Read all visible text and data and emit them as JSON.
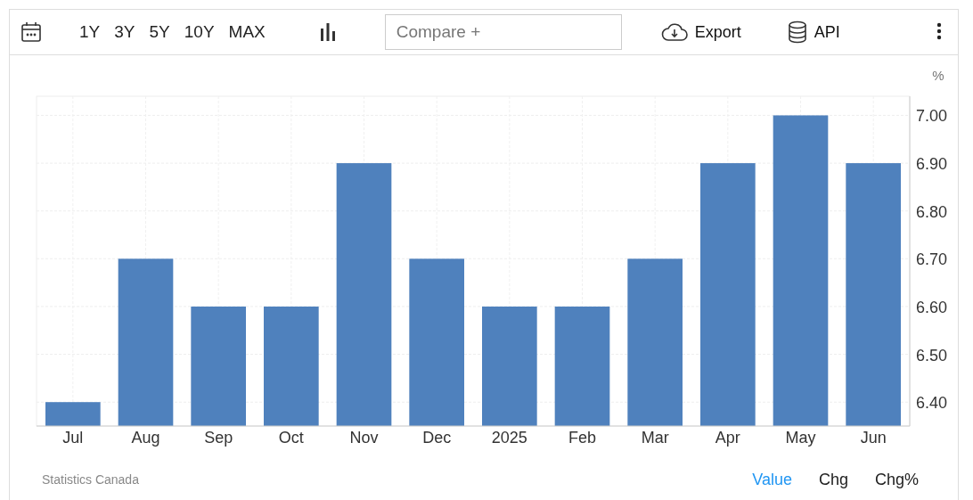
{
  "toolbar": {
    "ranges": [
      {
        "label": "1Y"
      },
      {
        "label": "3Y"
      },
      {
        "label": "5Y"
      },
      {
        "label": "10Y"
      },
      {
        "label": "MAX"
      }
    ],
    "compare": {
      "placeholder": "Compare +"
    },
    "export": "Export",
    "api": "API"
  },
  "chart": {
    "unit": "%",
    "chart_data": {
      "type": "bar",
      "categories": [
        "Jul",
        "Aug",
        "Sep",
        "Oct",
        "Nov",
        "Dec",
        "2025",
        "Feb",
        "Mar",
        "Apr",
        "May",
        "Jun"
      ],
      "grid": true,
      "series": [
        {
          "color": "#4f81bd",
          "values": [
            6.4,
            6.7,
            6.6,
            6.6,
            6.9,
            6.7,
            6.6,
            6.6,
            6.7,
            6.9,
            7.0,
            6.9
          ]
        }
      ],
      "ylim": [
        6.35,
        7.04
      ],
      "yticks": [
        {
          "value": 6.4,
          "label": "6.40"
        },
        {
          "value": 6.5,
          "label": "6.50"
        },
        {
          "value": 6.6,
          "label": "6.60"
        },
        {
          "value": 6.7,
          "label": "6.70"
        },
        {
          "value": 6.8,
          "label": "6.80"
        },
        {
          "value": 6.9,
          "label": "6.90"
        },
        {
          "value": 7.0,
          "label": "7.00"
        }
      ]
    }
  },
  "footer": {
    "source": "Statistics Canada",
    "views": [
      {
        "label": "Value",
        "selected": true
      },
      {
        "label": "Chg",
        "selected": false
      },
      {
        "label": "Chg%",
        "selected": false
      }
    ]
  }
}
